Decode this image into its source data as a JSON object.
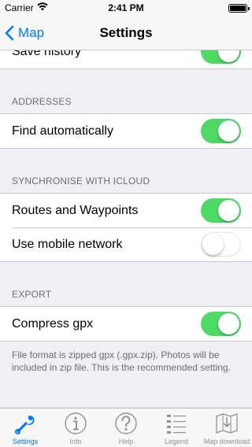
{
  "status_bar": {
    "carrier": "Carrier",
    "time": "2:41 PM"
  },
  "nav": {
    "back_label": "Map",
    "title": "Settings"
  },
  "history": {
    "label": "Save history",
    "enabled": true
  },
  "addresses": {
    "header": "ADDRESSES",
    "find_automatically": {
      "label": "Find automatically",
      "enabled": true
    }
  },
  "icloud": {
    "header": "SYNCHRONISE WITH ICLOUD",
    "routes": {
      "label": "Routes and Waypoints",
      "enabled": true
    },
    "mobile": {
      "label": "Use mobile network",
      "enabled": false
    }
  },
  "export": {
    "header": "EXPORT",
    "compress": {
      "label": "Compress gpx",
      "enabled": true
    },
    "footer": "File format is zipped gpx (.gpx.zip). Photos will be included in zip file. This is the recommended setting."
  },
  "tabs": [
    {
      "label": "Settings",
      "icon": "wrench-icon",
      "active": true
    },
    {
      "label": "Info",
      "icon": "info-icon",
      "active": false
    },
    {
      "label": "Help",
      "icon": "help-icon",
      "active": false
    },
    {
      "label": "Legend",
      "icon": "legend-icon",
      "active": false
    },
    {
      "label": "Map download",
      "icon": "map-download-icon",
      "active": false
    }
  ],
  "colors": {
    "accent": "#007aff",
    "switch_on": "#4cd964",
    "background": "#efeff4",
    "secondary_text": "#6d6d72"
  }
}
